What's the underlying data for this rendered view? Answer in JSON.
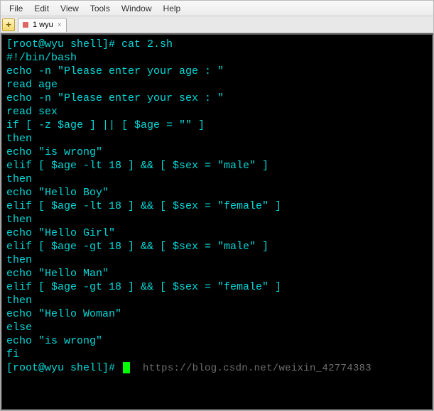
{
  "menubar": {
    "items": [
      "File",
      "Edit",
      "View",
      "Tools",
      "Window",
      "Help"
    ]
  },
  "tabbar": {
    "add_label": "+",
    "tab": {
      "label": "1 wyu",
      "close": "×"
    }
  },
  "terminal": {
    "lines": [
      "[root@wyu shell]# cat 2.sh",
      "#!/bin/bash",
      "echo -n \"Please enter your age : \"",
      "read age",
      "echo -n \"Please enter your sex : \"",
      "read sex",
      "if [ -z $age ] || [ $age = \"\" ]",
      "then",
      "echo \"is wrong\"",
      "elif [ $age -lt 18 ] && [ $sex = \"male\" ]",
      "then",
      "echo \"Hello Boy\"",
      "elif [ $age -lt 18 ] && [ $sex = \"female\" ]",
      "then",
      "echo \"Hello Girl\"",
      "elif [ $age -gt 18 ] && [ $sex = \"male\" ]",
      "then",
      "echo \"Hello Man\"",
      "elif [ $age -gt 18 ] && [ $sex = \"female\" ]",
      "then",
      "echo \"Hello Woman\"",
      "else",
      "echo \"is wrong\"",
      "fi"
    ],
    "final_prompt": "[root@wyu shell]# ",
    "watermark": "https://blog.csdn.net/weixin_42774383"
  }
}
